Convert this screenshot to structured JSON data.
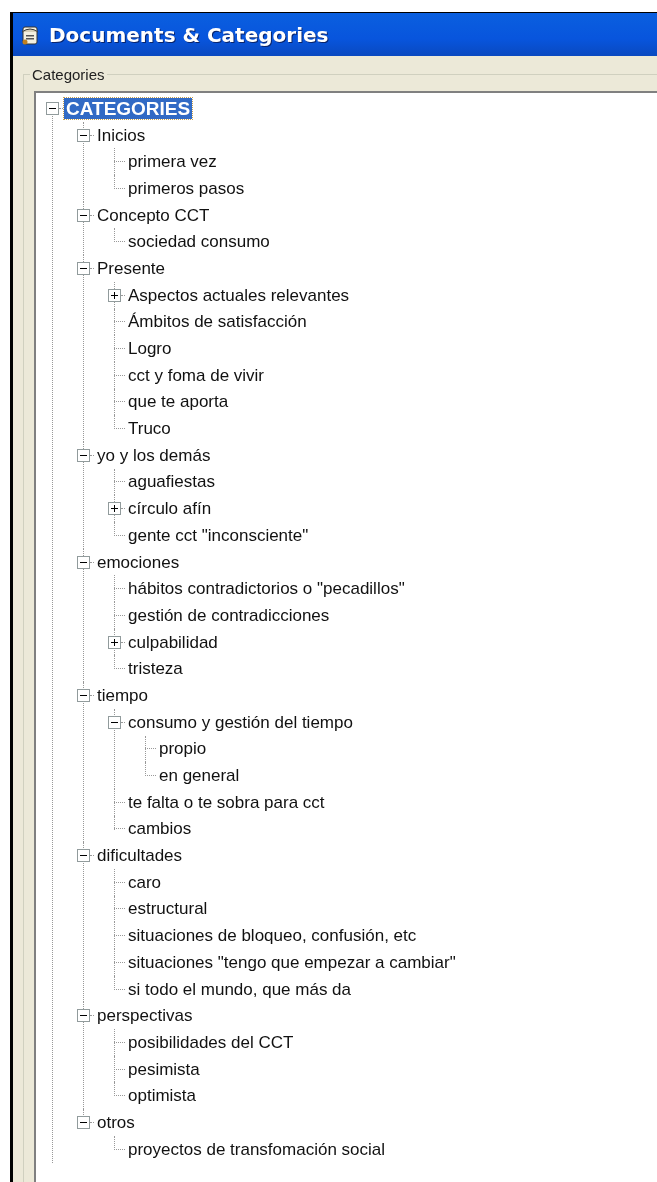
{
  "window": {
    "title": "Documents & Categories"
  },
  "group": {
    "label": "Categories"
  },
  "tree": [
    {
      "label": "CATEGORIES",
      "selected": true,
      "expanded": true,
      "children": [
        {
          "label": "Inicios",
          "selected": false,
          "expanded": true,
          "children": [
            {
              "label": "primera vez",
              "selected": false
            },
            {
              "label": "primeros pasos",
              "selected": false
            }
          ]
        },
        {
          "label": "Concepto CCT",
          "selected": false,
          "expanded": true,
          "children": [
            {
              "label": "sociedad consumo",
              "selected": false
            }
          ]
        },
        {
          "label": "Presente",
          "selected": false,
          "expanded": true,
          "children": [
            {
              "label": "Aspectos actuales relevantes",
              "selected": false,
              "expanded": false
            },
            {
              "label": "Ámbitos de satisfacción",
              "selected": false
            },
            {
              "label": "Logro",
              "selected": false
            },
            {
              "label": "cct y foma de vivir",
              "selected": false
            },
            {
              "label": "que te aporta",
              "selected": false
            },
            {
              "label": "Truco",
              "selected": false
            }
          ]
        },
        {
          "label": "yo y los demás",
          "selected": false,
          "expanded": true,
          "children": [
            {
              "label": "aguafiestas",
              "selected": false
            },
            {
              "label": "círculo afín",
              "selected": false,
              "expanded": false
            },
            {
              "label": "gente cct \"inconsciente\"",
              "selected": false
            }
          ]
        },
        {
          "label": "emociones",
          "selected": false,
          "expanded": true,
          "children": [
            {
              "label": "hábitos contradictorios o \"pecadillos\"",
              "selected": false
            },
            {
              "label": "gestión de contradicciones",
              "selected": false
            },
            {
              "label": "culpabilidad",
              "selected": false,
              "expanded": false
            },
            {
              "label": "tristeza",
              "selected": false
            }
          ]
        },
        {
          "label": "tiempo",
          "selected": false,
          "expanded": true,
          "children": [
            {
              "label": "consumo y gestión del tiempo",
              "selected": false,
              "expanded": true,
              "children": [
                {
                  "label": "propio",
                  "selected": false
                },
                {
                  "label": "en general",
                  "selected": false
                }
              ]
            },
            {
              "label": "te falta o te sobra para cct",
              "selected": false
            },
            {
              "label": "cambios",
              "selected": false
            }
          ]
        },
        {
          "label": "dificultades",
          "selected": false,
          "expanded": true,
          "children": [
            {
              "label": "caro",
              "selected": false
            },
            {
              "label": "estructural",
              "selected": false
            },
            {
              "label": "situaciones de bloqueo, confusión, etc",
              "selected": false
            },
            {
              "label": "situaciones \"tengo que empezar a cambiar\"",
              "selected": false
            },
            {
              "label": "si todo el mundo, que más da",
              "selected": false
            }
          ]
        },
        {
          "label": "perspectivas",
          "selected": false,
          "expanded": true,
          "children": [
            {
              "label": "posibilidades del CCT",
              "selected": false
            },
            {
              "label": "pesimista",
              "selected": false
            },
            {
              "label": "optimista",
              "selected": false
            }
          ]
        },
        {
          "label": "otros",
          "selected": false,
          "expanded": true,
          "children": [
            {
              "label": "proyectos de transfomación social",
              "selected": false
            }
          ]
        }
      ]
    }
  ]
}
